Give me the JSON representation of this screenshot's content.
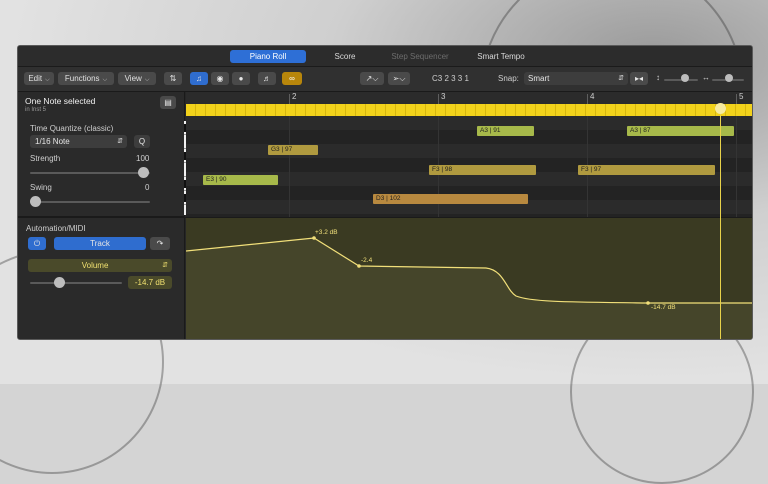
{
  "tabs": [
    {
      "label": "Piano Roll",
      "active": true
    },
    {
      "label": "Score",
      "active": false
    },
    {
      "label": "Step Sequencer",
      "active": false,
      "disabled": true
    },
    {
      "label": "Smart Tempo",
      "active": false
    }
  ],
  "toolbar": {
    "edit_label": "Edit",
    "functions_label": "Functions",
    "view_label": "View",
    "pitch_display": "C3  2 3 3 1",
    "snap_label": "Snap:",
    "snap_value": "Smart",
    "snap_icon": "snap-icon"
  },
  "inspector": {
    "title": "One Note selected",
    "subtitle": "in Inst 5",
    "time_quantize_label": "Time Quantize (classic)",
    "quantize_value": "1/16 Note",
    "quantize_button": "Q",
    "strength_label": "Strength",
    "strength_value": "100",
    "swing_label": "Swing",
    "swing_value": "0",
    "automation_label": "Automation/MIDI",
    "track_button": "Track",
    "parameter": "Volume",
    "volume_value": "-14.7 dB"
  },
  "ruler": {
    "bars": [
      "2",
      "3",
      "4",
      "5"
    ]
  },
  "notes": [
    {
      "label": "A3 | 91"
    },
    {
      "label": "A3 | 87"
    },
    {
      "label": "G3 | 97"
    },
    {
      "label": "F3 | 98"
    },
    {
      "label": "F3 | 97"
    },
    {
      "label": "E3 | 90"
    },
    {
      "label": "D3 | 102"
    }
  ],
  "automation_points": [
    {
      "label": "+3.2 dB"
    },
    {
      "label": "-2.4"
    },
    {
      "label": "-14.7 dB"
    }
  ],
  "colors": {
    "accent": "#2e6fd6",
    "cycle": "#f2d21b",
    "note_green": "#a7b94a",
    "note_olive": "#b09a3f",
    "note_orange": "#b8893f",
    "automation_line": "#f2e07a"
  }
}
